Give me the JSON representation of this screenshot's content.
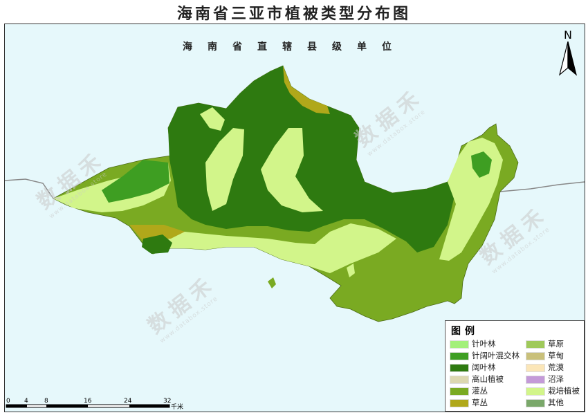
{
  "title": "海南省三亚市植被类型分布图",
  "region_label": "海南省直辖县级单位",
  "north_label": "N",
  "legend": {
    "title": "图例",
    "items": [
      {
        "label": "针叶林",
        "color": "#a3f07a"
      },
      {
        "label": "草原",
        "color": "#9fc95a"
      },
      {
        "label": "针阔叶混交林",
        "color": "#3e9e22"
      },
      {
        "label": "草甸",
        "color": "#c9c07a"
      },
      {
        "label": "阔叶林",
        "color": "#2e7a10"
      },
      {
        "label": "荒漠",
        "color": "#fbe6b8"
      },
      {
        "label": "高山植被",
        "color": "#dcd8b0"
      },
      {
        "label": "沼泽",
        "color": "#c49ad8"
      },
      {
        "label": "灌丛",
        "color": "#7aaa22"
      },
      {
        "label": "栽培植被",
        "color": "#d2f58a"
      },
      {
        "label": "草丛",
        "color": "#b0a81a"
      },
      {
        "label": "其他",
        "color": "#7aa86a"
      }
    ]
  },
  "scale": {
    "ticks": [
      "0",
      "4",
      "8",
      "16",
      "24",
      "32"
    ],
    "unit": "千米"
  },
  "watermark": {
    "text": "数据禾",
    "sub": "www.databox.store"
  }
}
